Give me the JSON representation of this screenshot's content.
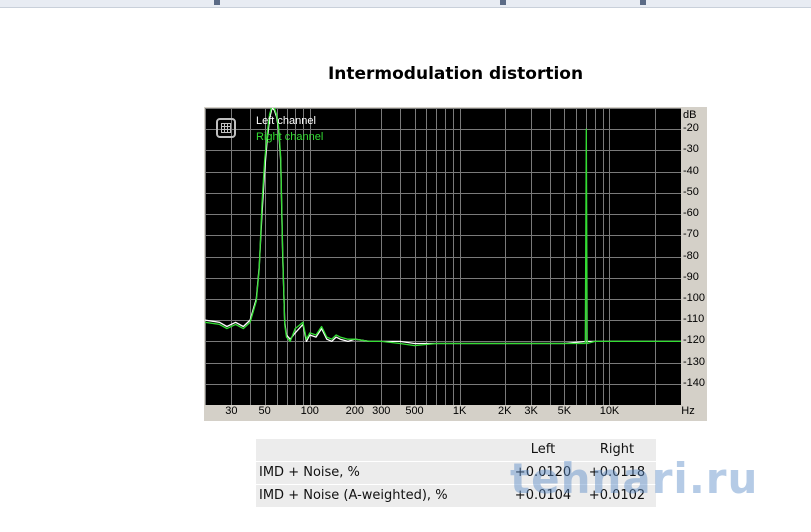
{
  "page": {
    "title": "Intermodulation distortion"
  },
  "chart_data": {
    "type": "line",
    "x_scale": "log",
    "xlim": [
      20,
      30000
    ],
    "ylim": [
      -150,
      -10
    ],
    "y_unit_label": "dB",
    "x_unit_label": "Hz",
    "grid": true,
    "legend_placement": "top-left",
    "y_ticks": [
      "-20",
      "-30",
      "-40",
      "-50",
      "-60",
      "-70",
      "-80",
      "-90",
      "-100",
      "-110",
      "-120",
      "-130",
      "-140"
    ],
    "x_ticks": [
      {
        "label": "30",
        "value": 30
      },
      {
        "label": "50",
        "value": 50
      },
      {
        "label": "100",
        "value": 100
      },
      {
        "label": "200",
        "value": 200
      },
      {
        "label": "300",
        "value": 300
      },
      {
        "label": "500",
        "value": 500
      },
      {
        "label": "1K",
        "value": 1000
      },
      {
        "label": "2K",
        "value": 2000
      },
      {
        "label": "3K",
        "value": 3000
      },
      {
        "label": "5K",
        "value": 5000
      },
      {
        "label": "10K",
        "value": 10000
      }
    ],
    "series": [
      {
        "name": "Left channel",
        "color": "#ffffff",
        "x": [
          20,
          25,
          28,
          32,
          36,
          40,
          44,
          46,
          48,
          50,
          52,
          54,
          56,
          58,
          60,
          62,
          64,
          66,
          68,
          70,
          74,
          80,
          90,
          95,
          100,
          110,
          120,
          130,
          140,
          150,
          160,
          180,
          200,
          250,
          300,
          400,
          500,
          700,
          1000,
          1500,
          2000,
          3000,
          5000,
          7000,
          8000,
          10000,
          15000,
          20000,
          30000
        ],
        "y": [
          -110,
          -111,
          -113,
          -111,
          -113,
          -110,
          -100,
          -85,
          -60,
          -40,
          -25,
          -15,
          -10,
          -11,
          -14,
          -20,
          -35,
          -80,
          -111,
          -117,
          -119,
          -116,
          -112,
          -120,
          -117,
          -118,
          -114,
          -119,
          -120,
          -118,
          -119,
          -120,
          -119,
          -120,
          -120,
          -120,
          -121,
          -121,
          -121,
          -121,
          -121,
          -121,
          -121,
          -120,
          -120,
          -120,
          -120,
          -120,
          -120
        ]
      },
      {
        "name": "Right channel",
        "color": "#33dd33",
        "x": [
          20,
          25,
          28,
          32,
          36,
          40,
          44,
          46,
          48,
          50,
          52,
          54,
          56,
          58,
          60,
          62,
          64,
          66,
          68,
          70,
          74,
          80,
          90,
          95,
          100,
          110,
          120,
          130,
          140,
          150,
          160,
          180,
          200,
          250,
          300,
          400,
          500,
          700,
          1000,
          1500,
          2000,
          3000,
          5000,
          6900,
          7000,
          7100,
          8000,
          10000,
          15000,
          20000,
          30000
        ],
        "y": [
          -111,
          -112,
          -114,
          -112,
          -114,
          -111,
          -101,
          -86,
          -55,
          -35,
          -22,
          -13,
          -9,
          -10,
          -13,
          -19,
          -33,
          -78,
          -112,
          -118,
          -120,
          -114,
          -111,
          -119,
          -116,
          -117,
          -113,
          -118,
          -119,
          -117,
          -118,
          -119,
          -119,
          -120,
          -120,
          -121,
          -122,
          -121,
          -121,
          -121,
          -121,
          -121,
          -121,
          -121,
          -20,
          -121,
          -120,
          -120,
          -120,
          -120,
          -120
        ]
      }
    ]
  },
  "metrics": {
    "columns": [
      "Left",
      "Right"
    ],
    "rows": [
      {
        "label": "IMD + Noise, %",
        "left": "+0.0120",
        "right": "+0.0118"
      },
      {
        "label": "IMD + Noise (A-weighted), %",
        "left": "+0.0104",
        "right": "+0.0102"
      }
    ]
  },
  "watermark": "tehnari.ru"
}
